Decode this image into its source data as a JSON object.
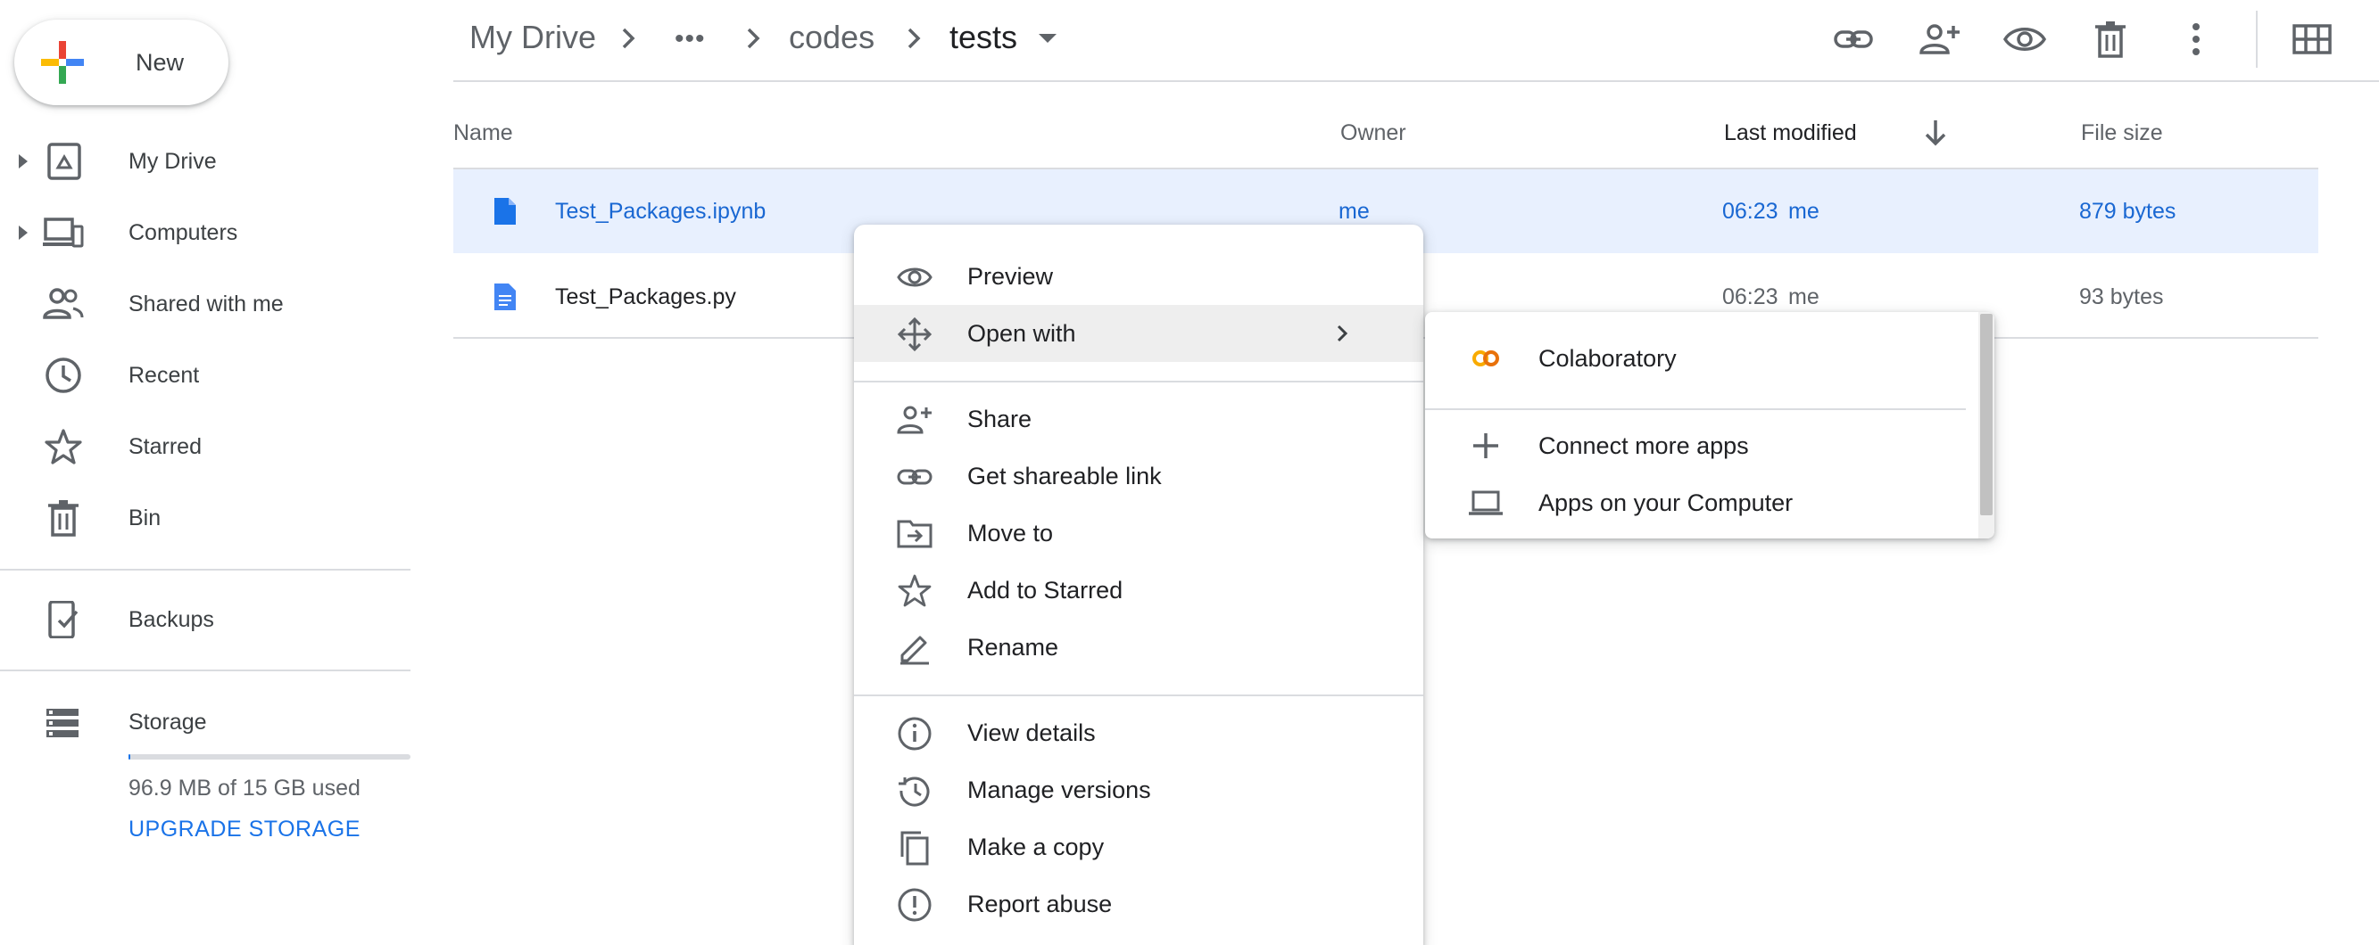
{
  "new_button": {
    "label": "New"
  },
  "sidebar": {
    "items": [
      {
        "label": "My Drive",
        "icon": "drive-icon"
      },
      {
        "label": "Computers",
        "icon": "computers-icon"
      },
      {
        "label": "Shared with me",
        "icon": "people-icon"
      },
      {
        "label": "Recent",
        "icon": "clock-icon"
      },
      {
        "label": "Starred",
        "icon": "star-icon"
      },
      {
        "label": "Bin",
        "icon": "trash-icon"
      }
    ],
    "backups": {
      "label": "Backups",
      "icon": "backup-icon"
    },
    "storage": {
      "label": "Storage",
      "icon": "storage-icon",
      "used_text": "96.9 MB of 15 GB used",
      "used_fraction": 0.0063,
      "upgrade_label": "UPGRADE STORAGE"
    }
  },
  "breadcrumb": {
    "root": "My Drive",
    "ellipsis": "•••",
    "folder": "codes",
    "current": "tests"
  },
  "toolbar": {
    "icons": [
      "link-icon",
      "share-person-icon",
      "preview-eye-icon",
      "delete-icon",
      "more-vert-icon",
      "grid-view-icon"
    ]
  },
  "table": {
    "headers": {
      "name": "Name",
      "owner": "Owner",
      "modified": "Last modified",
      "size": "File size"
    },
    "rows": [
      {
        "name": "Test_Packages.ipynb",
        "owner": "me",
        "modified_time": "06:23",
        "modified_by": "me",
        "size": "879 bytes",
        "selected": true
      },
      {
        "name": "Test_Packages.py",
        "owner": "me",
        "modified_time": "06:23",
        "modified_by": "me",
        "size": "93 bytes",
        "selected": false
      }
    ]
  },
  "context_menu": {
    "items": [
      {
        "label": "Preview",
        "icon": "eye-icon"
      },
      {
        "label": "Open with",
        "icon": "move-arrows-icon"
      },
      {
        "label": "Share",
        "icon": "person-add-icon"
      },
      {
        "label": "Get shareable link",
        "icon": "link-icon"
      },
      {
        "label": "Move to",
        "icon": "folder-move-icon"
      },
      {
        "label": "Add to Starred",
        "icon": "star-icon"
      },
      {
        "label": "Rename",
        "icon": "pencil-icon"
      },
      {
        "label": "View details",
        "icon": "info-icon"
      },
      {
        "label": "Manage versions",
        "icon": "history-icon"
      },
      {
        "label": "Make a copy",
        "icon": "copy-icon"
      },
      {
        "label": "Report abuse",
        "icon": "alert-icon"
      }
    ]
  },
  "open_with_submenu": {
    "items": [
      {
        "label": "Colaboratory",
        "icon": "colab-icon"
      },
      {
        "label": "Connect more apps",
        "icon": "plus-icon"
      },
      {
        "label": "Apps on your Computer",
        "icon": "laptop-icon"
      }
    ]
  },
  "colors": {
    "accent": "#1a73e8",
    "selected_row": "#e8f0fe",
    "selected_text": "#1967d2",
    "colab": "#f9ab00"
  }
}
